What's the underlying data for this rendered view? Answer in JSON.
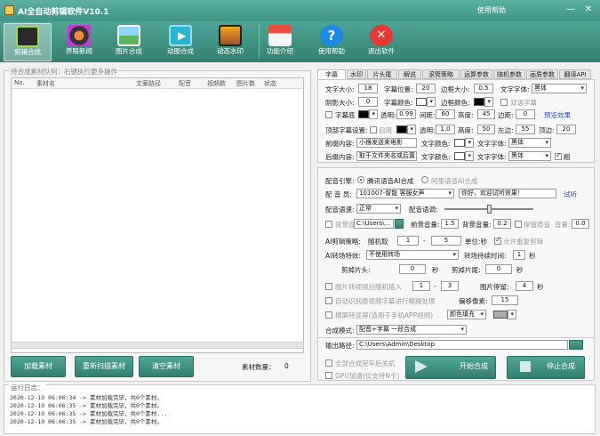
{
  "window": {
    "title": "AI全自动剪辑软件V10.1",
    "help": "使用帮助"
  },
  "toolbar": [
    {
      "label": "剪辑合成",
      "icon": "clapper-icon"
    },
    {
      "label": "养眼新闻",
      "icon": "film-reel-icon"
    },
    {
      "label": "图片合成",
      "icon": "picture-icon"
    },
    {
      "label": "动图合成",
      "icon": "play-frame-icon"
    },
    {
      "label": "动态水印",
      "icon": "photo-frame-icon"
    },
    {
      "label": "功能介绍",
      "icon": "home-icon"
    },
    {
      "label": "使用帮助",
      "icon": "help-icon"
    },
    {
      "label": "退出软件",
      "icon": "exit-icon"
    }
  ],
  "queue": {
    "legend": "待合成素材队列：右键执行更多操作",
    "columns": [
      "No.",
      "素材名",
      "文案路径",
      "配音",
      "视频数",
      "图片数",
      "状态"
    ],
    "buttons": {
      "add": "加载素材",
      "rescan": "重新扫描素材",
      "clear": "清空素材"
    },
    "count_label": "素材数量：",
    "count": "0"
  },
  "tabs": [
    "字幕",
    "水印",
    "片头尾",
    "解说",
    "滚筒策略",
    "运算参数",
    "随机参数",
    "画质参数",
    "翻译API"
  ],
  "subtitle": {
    "font_size_label": "文字大小:",
    "font_size": "18",
    "pos_label": "字幕位置:",
    "pos": "20",
    "border_label": "边框大小:",
    "border": "0.5",
    "font_label": "文字字体:",
    "font": "黑体",
    "shadow_label": "阴影大小:",
    "shadow": "0",
    "color_label": "字幕颜色:",
    "bordercolor_label": "边框颜色:",
    "dual_label": "双语字幕",
    "bg_label": "字幕底",
    "opacity_label": "透明:",
    "opacity": "0.99",
    "spacing_label": "间距:",
    "spacing": "60",
    "height_label": "高度:",
    "height": "45",
    "margin_label": "边距:",
    "margin": "0",
    "preview": "预览效果",
    "top_label": "顶部字幕设置:",
    "enable_label": "启用",
    "top_opacity": "1.0",
    "top_height": "50",
    "top_left_label": "左边:",
    "top_left": "55",
    "top_right_label": "顶边:",
    "top_right": "20",
    "prefix_label": "前缀内容:",
    "prefix": "小猴发送来电影",
    "text_color_label": "文字颜色:",
    "text_font_label": "文字字体:",
    "text_font": "黑体",
    "suffix_label": "后缀内容:",
    "suffix": "取于文件夹名或后置",
    "suffix_font": "黑体",
    "bold_label": "粗"
  },
  "voice": {
    "engine_label": "配音引擎:",
    "engine_opt1": "腾讯语音AI合成",
    "engine_opt2": "阿里语音AI合成",
    "voice_label": "配 音 员:",
    "voice": "101007-智能 客服女声",
    "test_text": "你好，欢迎试听效果！",
    "listen": "试听",
    "speed_label": "配音语速:",
    "speed": "正常",
    "tone_label": "配音语调:",
    "bgm_label": "背景音",
    "bgm_path": "C:\\Users\\...",
    "bgm_vol_label": "前景音量:",
    "bgm_vol": "1.5",
    "bg_vol_label": "背景音量:",
    "bg_vol": "0.2",
    "keep_label": "保留原音",
    "keep_vol_label": "音量:",
    "keep_vol": "0.0",
    "ai_label": "AI剪辑策略:",
    "random_label": "随机取",
    "r_from": "1",
    "r_to": "5",
    "unit_label": "单位:秒",
    "repeat_label": "允许重复剪辑",
    "transition_label": "AI转场特效:",
    "transition": "不使用转场",
    "trans_time_label": "转场持续时间:",
    "trans_time": "1",
    "sec": "秒",
    "cut_head_label": "剪掉片头:",
    "cut_head": "0",
    "cut_tail_label": "剪掉片尾:",
    "cut_tail": "0",
    "img_insert_label": "图片转视频后随机插入",
    "img_from": "1",
    "img_to": "3",
    "img_dur_label": "图片停留:",
    "img_dur": "4",
    "blur_label": "自动识别原视频字幕进行模糊处理",
    "blur_offset_label": "偏移像素:",
    "blur_offset": "15",
    "vertical_label": "横屏转竖屏(适用于手机APP视频)",
    "fill": "颜色填充",
    "mode_label": "合成模式:",
    "mode": "配音+字幕 一段合成",
    "out_label": "输出路径:",
    "out_path": "C:\\Users\\Admin\\Desktop",
    "shutdown_label": "全部合成完毕后关机",
    "gpu_label": "GPU加速(仅支持N卡)",
    "start": "开始合成",
    "stop": "停止合成"
  },
  "log": {
    "legend": "运行日志：",
    "lines": [
      "2020-12-19 06:06:34 -> 素材加载完毕，共0个素材。",
      "2020-12-19 06:06:35 -> 素材加载完毕，共0个素材。",
      "2020-12-19 06:06:35 -> 素材加载完毕，共0个素材...",
      "2020-12-19 06:06:35 -> 素材加载完毕，共0个素材。"
    ]
  }
}
